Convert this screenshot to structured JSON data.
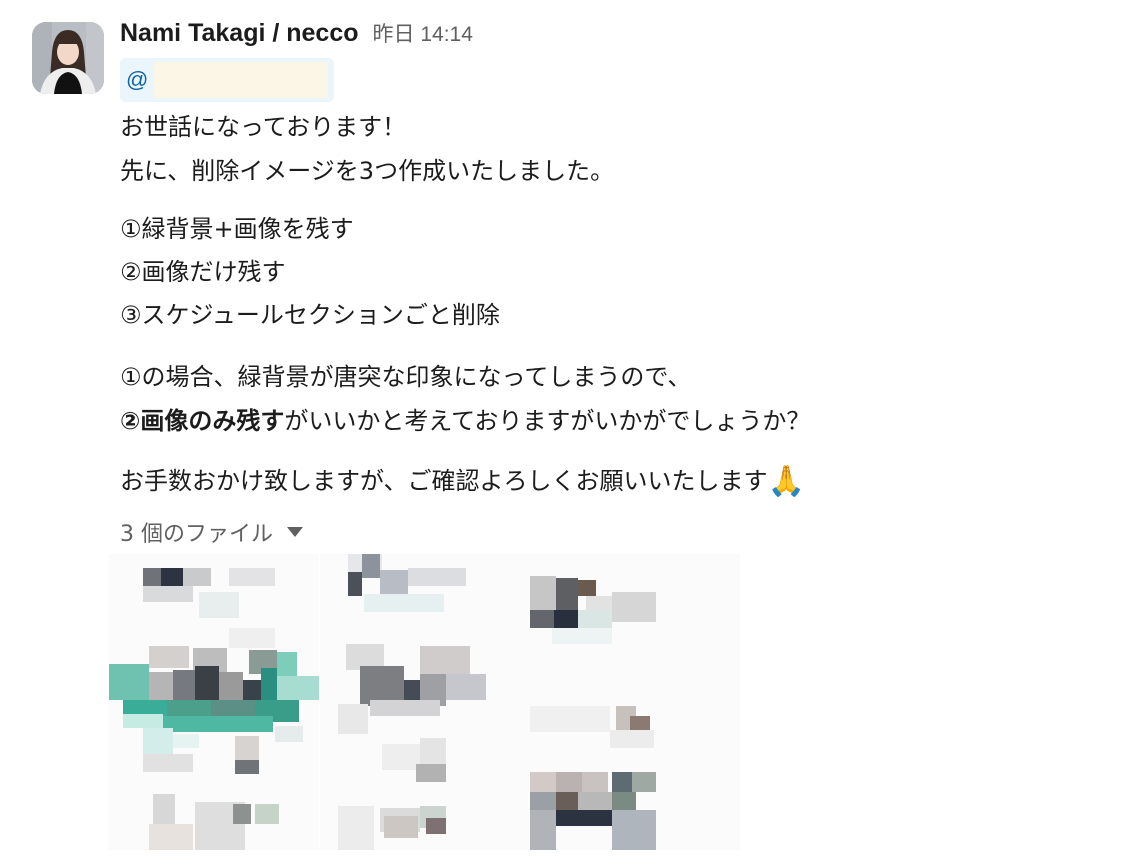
{
  "message": {
    "sender": "Nami Takagi / necco",
    "timestamp": "昨日 14:14",
    "mention": "@",
    "lines": [
      "お世話になっております！",
      "先に、削除イメージを3つ作成いたしました。",
      "①緑背景+画像を残す",
      "②画像だけ残す",
      "③スケジュールセクションごと削除",
      "①の場合、緑背景が唐突な印象になってしまうので、",
      "がいいかと考えておりますがいかがでしょうか？",
      "お手数おかけ致しますが、ご確認よろしくお願いいたします"
    ],
    "emphasis": "②画像のみ残す",
    "emoji": "🙏",
    "emoji_icon": "folded-hands-emoji"
  },
  "files": {
    "toggle_label": "3 個のファイル",
    "toggle_icon": "caret-down-icon",
    "count": 3,
    "thumbnail_style": "pixelated (blurred) image previews"
  },
  "colors": {
    "text": "#1d1c1d",
    "secondary_text": "#616061",
    "mention_background": "#eaf5fc",
    "mention_text": "#1264a3",
    "thumbnail_accent_green": "#3aad98"
  }
}
